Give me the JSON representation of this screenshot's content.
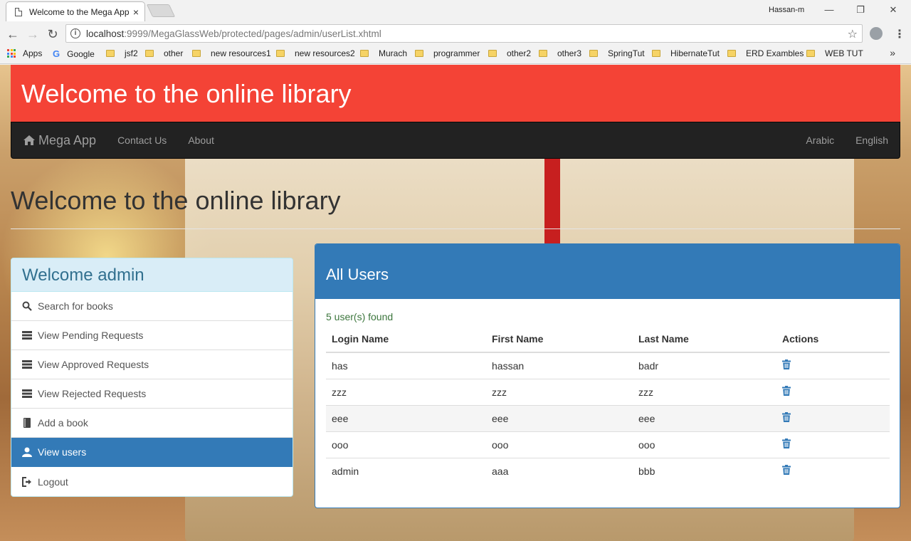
{
  "browser": {
    "tab_title": "Welcome to the Mega App",
    "tab_close": "×",
    "profile": "Hassan-m",
    "window_minimize": "—",
    "window_restore": "❐",
    "window_close": "✕",
    "back": "←",
    "forward": "→",
    "reload": "↻",
    "url_host": "localhost",
    "url_rest": ":9999/MegaGlassWeb/protected/pages/admin/userList.xhtml",
    "star": "☆",
    "menu": "⋮",
    "bookmarks": [
      "Apps",
      "Google",
      "jsf2",
      "other",
      "new resources1",
      "new resources2",
      "Murach",
      "programmer",
      "other2",
      "other3",
      "SpringTut",
      "HibernateTut",
      "ERD Exambles",
      "WEB TUT"
    ],
    "bookmarks_more": "»"
  },
  "jumbotron": {
    "title": "Welcome to the online library"
  },
  "navbar": {
    "brand": "Mega App",
    "links": [
      "Contact Us",
      "About"
    ],
    "right_links": [
      "Arabic",
      "English"
    ]
  },
  "page_header": "Welcome to the online library",
  "sidebar": {
    "heading": "Welcome admin",
    "items": [
      {
        "label": "Search for books",
        "icon": "search-icon"
      },
      {
        "label": "View Pending Requests",
        "icon": "list-icon"
      },
      {
        "label": "View Approved Requests",
        "icon": "list-icon"
      },
      {
        "label": "View Rejected Requests",
        "icon": "list-icon"
      },
      {
        "label": "Add a book",
        "icon": "book-icon"
      },
      {
        "label": "View users",
        "icon": "user-icon",
        "active": true
      },
      {
        "label": "Logout",
        "icon": "logout-icon"
      }
    ]
  },
  "users_panel": {
    "title": "All Users",
    "found": "5 user(s) found",
    "columns": [
      "Login Name",
      "First Name",
      "Last Name",
      "Actions"
    ],
    "rows": [
      [
        "has",
        "hassan",
        "badr"
      ],
      [
        "zzz",
        "zzz",
        "zzz"
      ],
      [
        "eee",
        "eee",
        "eee"
      ],
      [
        "ooo",
        "ooo",
        "ooo"
      ],
      [
        "admin",
        "aaa",
        "bbb"
      ]
    ]
  },
  "colors": {
    "jumbotron": "#f44336",
    "navbar": "#222222",
    "primary": "#337ab7",
    "info_heading": "#d9edf7",
    "success_text": "#3c763d"
  }
}
